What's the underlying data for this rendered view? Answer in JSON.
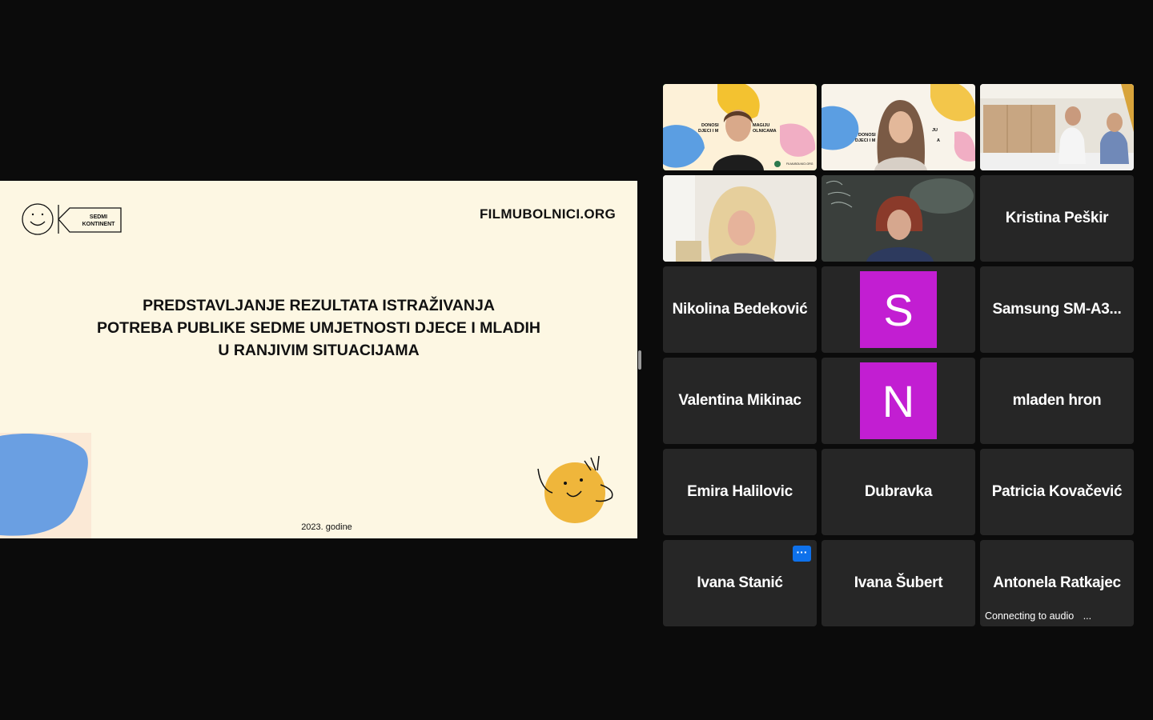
{
  "slide": {
    "logo_text_line1": "SEDMI",
    "logo_text_line2": "KONTINENT",
    "site": "FILMUBOLNICI.ORG",
    "title_lines": [
      "PREDSTAVLJANJE REZULTATA ISTRAŽIVANJA",
      "POTREBA PUBLIKE SEDME UMJETNOSTI DJECE I MLADIH",
      "U RANJIVIM SITUACIJAMA"
    ],
    "year": "2023. godine"
  },
  "video_tiles": {
    "t1_banner_a": "DONOSI",
    "t1_banner_b": "MAGIJU",
    "t1_banner_c": "DJECI I M",
    "t1_banner_d": "OLNICAMA",
    "t1_footer": "FILMUBOLNICI.ORG",
    "t2_banner_a": "DONOSI",
    "t2_banner_b": "JU",
    "t2_banner_c": "DJECI I M",
    "t2_banner_d": "A"
  },
  "participants": [
    "Kristina Peškir",
    "Nikolina Bedeković",
    "Samsung SM-A3...",
    "Valentina Mikinac",
    "mladen hron",
    "Emira Halilovic",
    "Dubravka",
    "Patricia Kovačević",
    "Ivana Stanić",
    "Ivana Šubert",
    "Antonela Ratkajec"
  ],
  "avatars": [
    "S",
    "N"
  ],
  "more_button": "···",
  "status_connecting": "Connecting to audio",
  "status_dots": "..."
}
